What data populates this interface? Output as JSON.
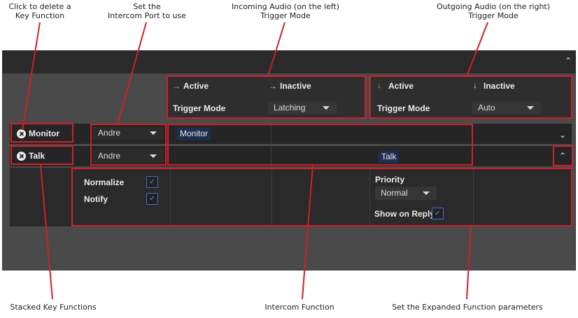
{
  "annotations": {
    "delete_key": [
      "Click to delete a",
      "Key Function"
    ],
    "intercom_port": [
      "Set the",
      "Intercom Port to use"
    ],
    "incoming_audio": [
      "Incoming Audio (on the left)",
      "Trigger Mode"
    ],
    "outgoing_audio": [
      "Outgoing Audio (on the right)",
      "Trigger Mode"
    ],
    "stacked": "Stacked Key Functions",
    "intercom_function": "Intercom Function",
    "expanded_params": "Set the Expanded Function parameters"
  },
  "incoming": {
    "active_label": "Active",
    "inactive_label": "Inactive",
    "trigger_label": "Trigger Mode",
    "trigger_value": "Latching"
  },
  "outgoing": {
    "active_label": "Active",
    "inactive_label": "Inactive",
    "trigger_label": "Trigger Mode",
    "trigger_value": "Auto"
  },
  "keys": [
    {
      "name": "Monitor",
      "port": "Andre",
      "function_label": "Monitor"
    },
    {
      "name": "Talk",
      "port": "Andre",
      "function_label": "Talk"
    }
  ],
  "expanded": {
    "normalize_label": "Normalize",
    "notify_label": "Notify",
    "priority_label": "Priority",
    "priority_value": "Normal",
    "show_on_reply_label": "Show on Reply"
  },
  "colors": {
    "highlight_red": "#d0202a",
    "incoming_icon": "#7ecf3a",
    "chip_bg": "#1f2f52",
    "checkbox_border": "#4a6cc8"
  }
}
